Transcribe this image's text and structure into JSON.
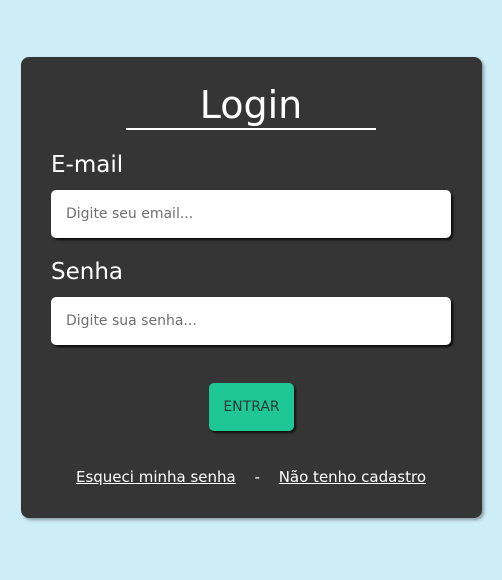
{
  "login": {
    "title": "Login",
    "email_label": "E-mail",
    "email_placeholder": "Digite seu email...",
    "password_label": "Senha",
    "password_placeholder": "Digite sua senha...",
    "submit_label": "ENTRAR",
    "forgot_link": "Esqueci minha senha",
    "separator": "-",
    "register_link": "Não tenho cadastro"
  },
  "colors": {
    "page_background": "#cdeef7",
    "card_background": "#353535",
    "button_accent": "#1fc796"
  }
}
